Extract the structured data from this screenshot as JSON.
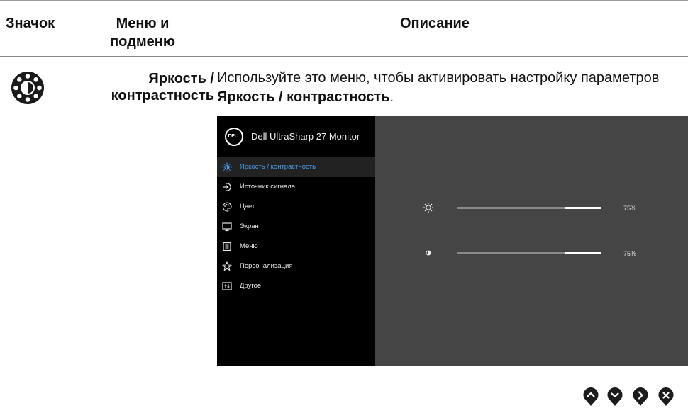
{
  "table": {
    "headers": {
      "icon": "Значок",
      "menu_line1": "Меню и",
      "menu_line2": "подменю",
      "description": "Описание"
    },
    "row": {
      "icon": "brightness-contrast-icon",
      "menu_line1": "Яркость /",
      "menu_line2": "контрастность",
      "desc_text": "Используйте это меню, чтобы активировать настройку параметров",
      "desc_bold": "Яркость / контрастность",
      "desc_end": "."
    }
  },
  "osd": {
    "logo": "DELL",
    "model": "Dell UltraSharp 27 Monitor",
    "accent_color": "#4a9ce6",
    "menu": [
      {
        "label": "Яркость / контрастность",
        "icon": "sun-icon",
        "active": true
      },
      {
        "label": "Источник сигнала",
        "icon": "input-source-icon",
        "active": false
      },
      {
        "label": "Цвет",
        "icon": "palette-icon",
        "active": false
      },
      {
        "label": "Экран",
        "icon": "display-icon",
        "active": false
      },
      {
        "label": "Меню",
        "icon": "menu-icon",
        "active": false
      },
      {
        "label": "Персонализация",
        "icon": "star-icon",
        "active": false
      },
      {
        "label": "Другое",
        "icon": "other-icon",
        "active": false
      }
    ],
    "sliders": [
      {
        "name": "brightness",
        "icon": "sun-icon",
        "value": 75,
        "value_label": "75%"
      },
      {
        "name": "contrast",
        "icon": "contrast-icon",
        "value": 75,
        "value_label": "75%"
      }
    ]
  },
  "nav_buttons": [
    {
      "name": "up",
      "icon": "chevron-up-icon"
    },
    {
      "name": "down",
      "icon": "chevron-down-icon"
    },
    {
      "name": "right",
      "icon": "chevron-right-icon"
    },
    {
      "name": "exit",
      "icon": "close-icon"
    }
  ]
}
